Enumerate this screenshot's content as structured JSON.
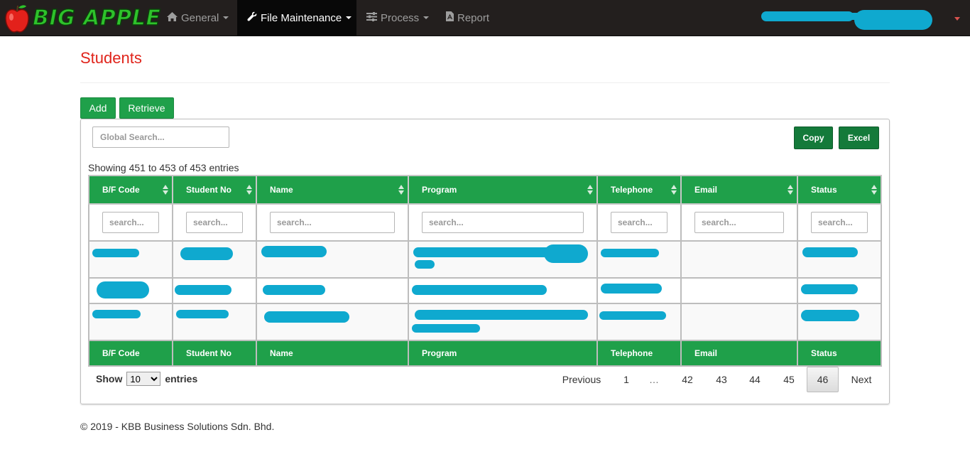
{
  "nav": {
    "brand": "BIG APPLE",
    "items": [
      {
        "label": "General",
        "icon": "home-icon"
      },
      {
        "label": "File Maintenance",
        "icon": "wrench-icon"
      },
      {
        "label": "Process",
        "icon": "sliders-icon"
      },
      {
        "label": "Report",
        "icon": "pdf-file-icon"
      }
    ]
  },
  "page": {
    "title": "Students"
  },
  "toolbar": {
    "add": "Add",
    "retrieve": "Retrieve",
    "copy": "Copy",
    "excel": "Excel"
  },
  "search": {
    "global_placeholder": "Global Search...",
    "column_placeholder": "search..."
  },
  "table": {
    "info": "Showing 451 to 453 of 453 entries",
    "columns": [
      "B/F Code",
      "Student No",
      "Name",
      "Program",
      "Telephone",
      "Email",
      "Status"
    ]
  },
  "length": {
    "show": "Show",
    "value": "10",
    "entries": "entries"
  },
  "pagination": {
    "previous": "Previous",
    "pages": [
      "1",
      "…",
      "42",
      "43",
      "44",
      "45",
      "46"
    ],
    "current": "46",
    "next": "Next"
  },
  "footer": {
    "copyright": "© 2019 - KBB Business Solutions Sdn. Bhd."
  },
  "colors": {
    "primary_green": "#1fa04a",
    "dark_green": "#147a3a",
    "title_red": "#e0241b",
    "navbar": "#231f1e",
    "redaction": "#0fa9cf"
  }
}
